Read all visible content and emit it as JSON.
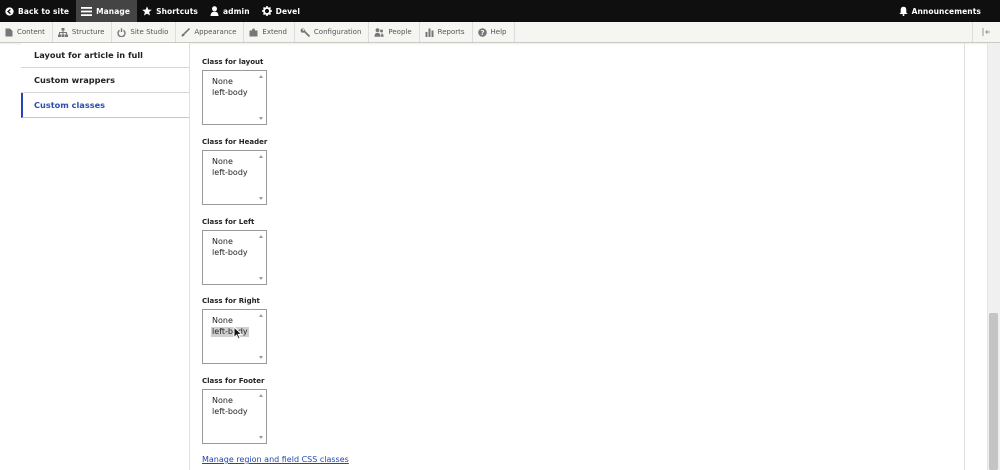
{
  "toolbar": {
    "back_to_site": "Back to site",
    "manage": "Manage",
    "shortcuts": "Shortcuts",
    "user": "admin",
    "devel": "Devel",
    "announcements": "Announcements"
  },
  "tray": {
    "items": [
      "Content",
      "Structure",
      "Site Studio",
      "Appearance",
      "Extend",
      "Configuration",
      "People",
      "Reports",
      "Help"
    ]
  },
  "vertical_tabs": [
    "Layout for article in full",
    "Custom wrappers",
    "Custom classes"
  ],
  "fields": [
    {
      "label": "Class for layout",
      "options": [
        "None",
        "left-body"
      ]
    },
    {
      "label": "Class for Header",
      "options": [
        "None",
        "left-body"
      ]
    },
    {
      "label": "Class for Left",
      "options": [
        "None",
        "left-body"
      ]
    },
    {
      "label": "Class for Right",
      "options": [
        "None",
        "left-body"
      ]
    },
    {
      "label": "Class for Footer",
      "options": [
        "None",
        "left-body"
      ]
    }
  ],
  "manage_link": "Manage region and field CSS classes",
  "colors": {
    "toolbar_bg": "#0f0f0f",
    "active_tab": "#444444",
    "link": "#2446b0",
    "selected_tab_text": "#2a4fb0"
  }
}
